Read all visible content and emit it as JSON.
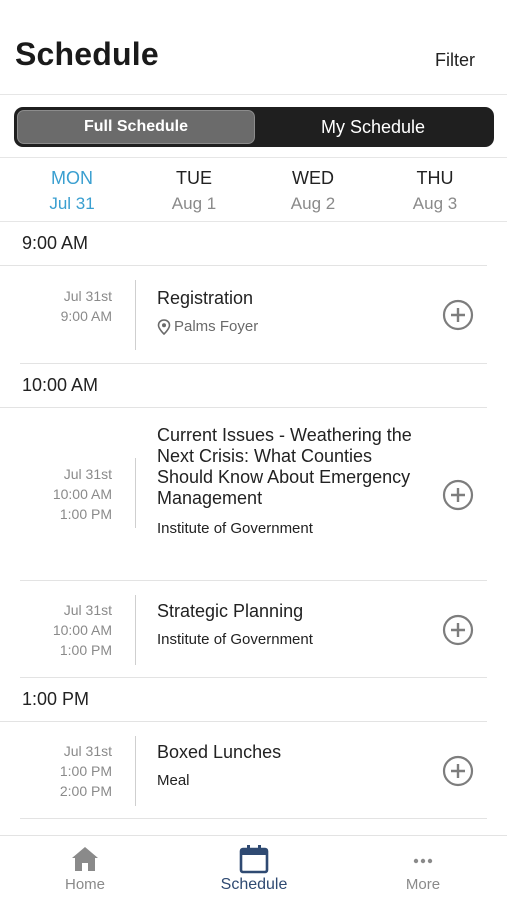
{
  "header": {
    "title": "Schedule",
    "filter_label": "Filter"
  },
  "segmented": {
    "full": "Full Schedule",
    "mine": "My Schedule",
    "selected": "full"
  },
  "days": [
    {
      "name": "MON",
      "date": "Jul 31",
      "active": true
    },
    {
      "name": "TUE",
      "date": "Aug 1",
      "active": false
    },
    {
      "name": "WED",
      "date": "Aug 2",
      "active": false
    },
    {
      "name": "THU",
      "date": "Aug 3",
      "active": false
    }
  ],
  "groups": [
    {
      "time": "9:00 AM",
      "sessions": [
        {
          "date": "Jul 31st",
          "start": "9:00 AM",
          "end": "",
          "title": "Registration",
          "location": "Palms Foyer",
          "track": ""
        }
      ]
    },
    {
      "time": "10:00 AM",
      "sessions": [
        {
          "date": "Jul 31st",
          "start": "10:00 AM",
          "end": "1:00 PM",
          "title": "Current Issues - Weathering the Next Crisis: What Counties Should Know About Emergency Management",
          "location": "",
          "track": "Institute of Government"
        },
        {
          "date": "Jul 31st",
          "start": "10:00 AM",
          "end": "1:00 PM",
          "title": "Strategic Planning",
          "location": "",
          "track": "Institute of Government"
        }
      ]
    },
    {
      "time": "1:00 PM",
      "sessions": [
        {
          "date": "Jul 31st",
          "start": "1:00 PM",
          "end": "2:00 PM",
          "title": "Boxed Lunches",
          "location": "",
          "track": "Meal"
        }
      ]
    }
  ],
  "tabs": [
    {
      "label": "Home",
      "icon": "home-icon",
      "active": false
    },
    {
      "label": "Schedule",
      "icon": "calendar-icon",
      "active": true
    },
    {
      "label": "More",
      "icon": "more-dots-icon",
      "active": false
    }
  ],
  "colors": {
    "accent": "#3a9fd0",
    "tab_active": "#2f4a72",
    "segment_bg": "#1f1f1f",
    "segment_active": "#6b6b6b"
  }
}
